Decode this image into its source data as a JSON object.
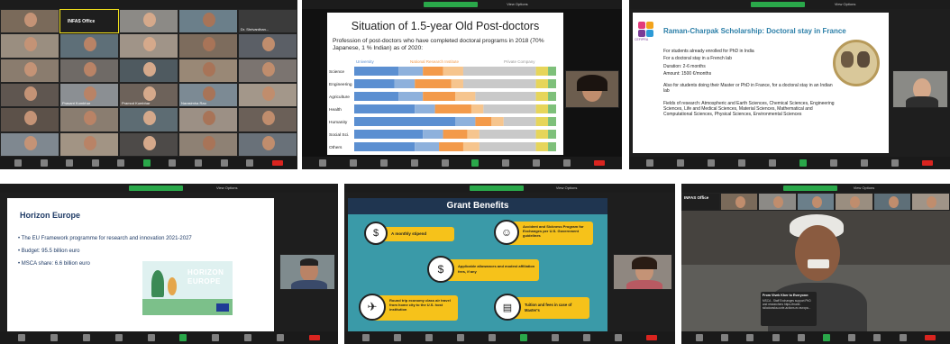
{
  "shot1": {
    "tiles": [
      "",
      "INFAS Office",
      "",
      "",
      "Dr. Shrivardhan...",
      "",
      "",
      "",
      "",
      "",
      "",
      "",
      "",
      "",
      "",
      "",
      "Prasant Kumbhar",
      "Pramod Kumbhar",
      "Narasimha Rao",
      "",
      "",
      "",
      "",
      "",
      "",
      "",
      "",
      "",
      "",
      "",
      ""
    ],
    "featured_name": "INFAS Office"
  },
  "shot2": {
    "title": "Situation of 1.5-year Old Post-doctors",
    "subtitle": "Profession of post-doctors who have  completed doctoral programs in 2018 (70% Japanese, 1 % Indian) as of 2020:",
    "legend": [
      "University",
      "National Research Institute",
      "Private Company"
    ],
    "categories": [
      "Science",
      "Engineering",
      "Agriculture",
      "Health",
      "Humanity",
      "Social Sci.",
      "Others"
    ]
  },
  "shot3": {
    "title": "Raman-Charpak Scholarship: Doctoral stay in France",
    "lines": [
      "For students already enrolled for PhD in India",
      "For a doctoral stay in a French lab",
      "Duration: 2-6 months",
      "Amount: 1500 €/months",
      "Also for students doing their Master or PhD in France, for a doctoral stay in an Indian lab",
      "Fields of research: Atmospheric and Earth Sciences, Chemical Sciences, Engineering Sciences, Life and Medical Sciences, Material Sciences, Mathematical and Computational Sciences, Physical Sciences, Environmental Sciences"
    ],
    "logo_text": "CEFIPRA"
  },
  "shot4": {
    "title": "Horizon Europe",
    "bullets": [
      "The EU Framework programme for research and innovation 2021-2027",
      "Budget: 95.5 billion euro",
      "MSCA share: 6.6 billion euro"
    ],
    "banner_line1": "HORIZON",
    "banner_line2": "EUROPE"
  },
  "shot5": {
    "title": "Grant Benefits",
    "items": [
      "A monthly stipend",
      "Accident and Sickness Program for Exchanges per U.S. Government guidelines",
      "Applicable allowances and modest affiliation fees, if any",
      "Round trip economy class air travel from home city to the U.S. host institution",
      "Tuition and fees in case of Master's"
    ]
  },
  "shot6": {
    "chat_from": "From Vivek Kher to Everyone:",
    "chat_msg": "MSCA - Staff Exchanges support PhD and researchers https://marie-sklodowska-curie-actions.ec.europa...",
    "office_label": "INFAS Office"
  },
  "colors": {
    "university": "#5b8fd1",
    "national": "#f39a4a",
    "private": "#c9c9c9",
    "grant_bg": "#3a9aa8",
    "grant_box": "#f6c21a"
  }
}
